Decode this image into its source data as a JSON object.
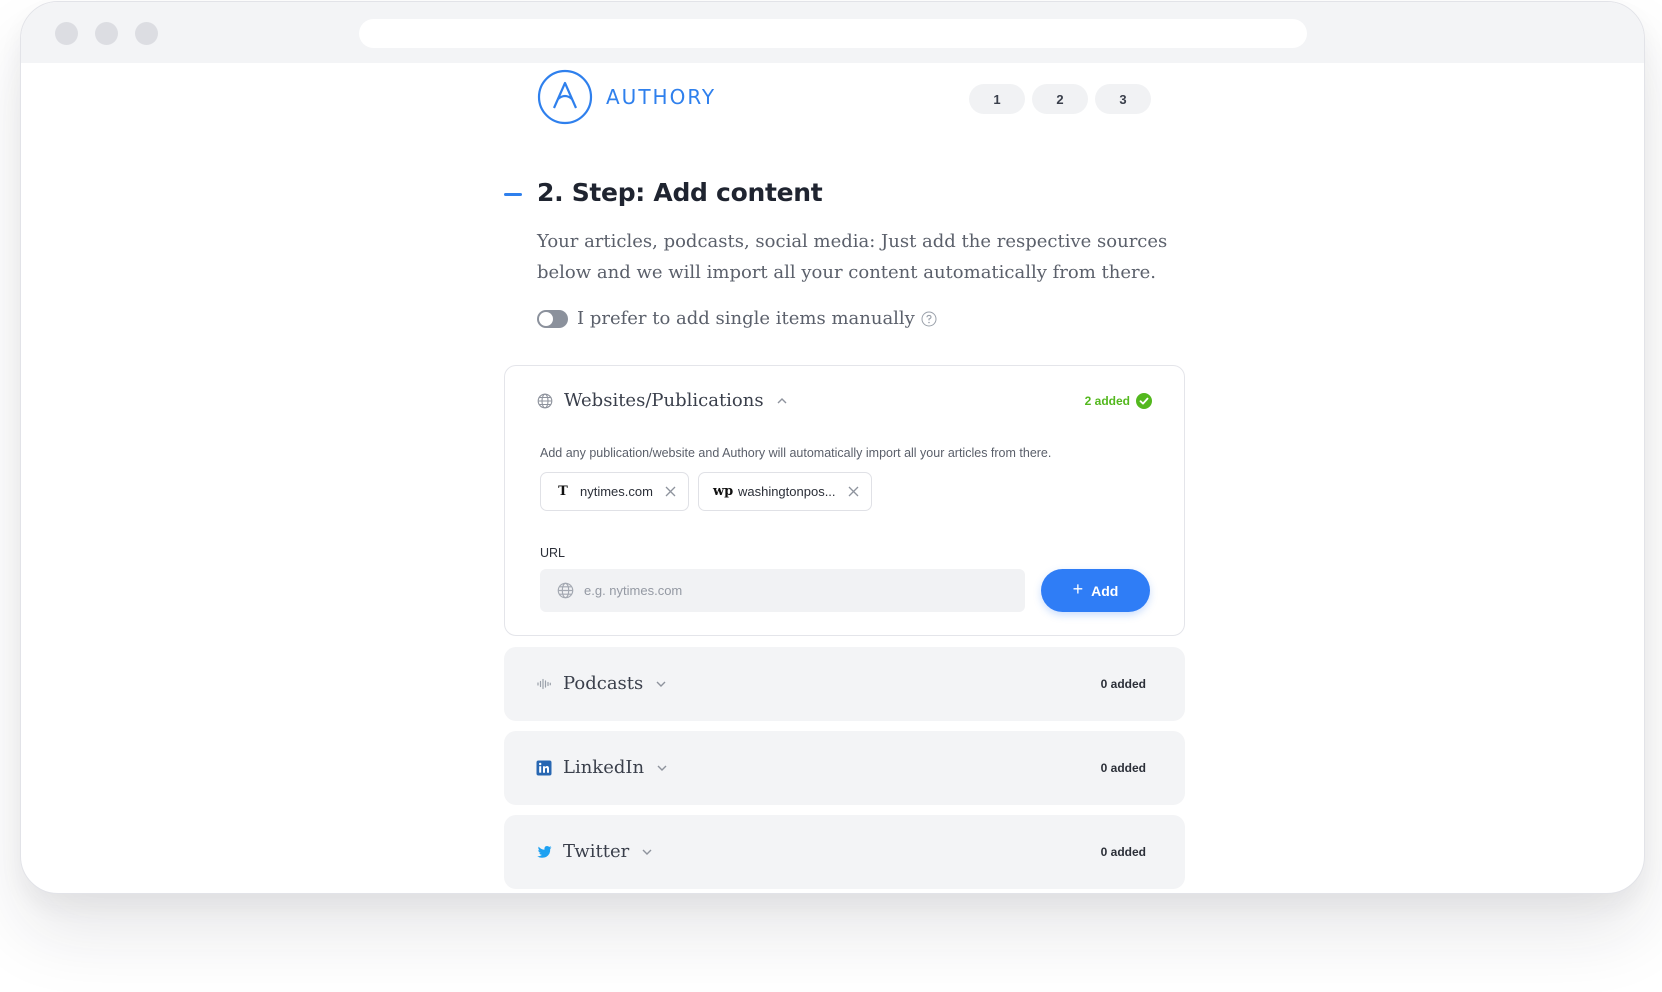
{
  "brand": {
    "name": "AUTHORY",
    "color": "#2f80ed"
  },
  "steps": [
    "1",
    "2",
    "3"
  ],
  "step": {
    "title": "2. Step: Add content",
    "description": "Your articles, podcasts, social media: Just add the respective sources below and we will import all your content automatically from there.",
    "toggle_label": "I prefer to add single items manually",
    "toggle_on": false
  },
  "websites": {
    "title": "Websites/Publications",
    "count_label": "2 added",
    "description": "Add any publication/website and Authory will automatically import all your articles from there.",
    "chips": [
      {
        "logo": "T",
        "label": "nytimes.com"
      },
      {
        "logo": "wp",
        "label": "washingtonpos..."
      }
    ],
    "url_label": "URL",
    "url_placeholder": "e.g. nytimes.com",
    "url_value": "",
    "add_label": "Add"
  },
  "sources": [
    {
      "title": "Podcasts",
      "count_label": "0 added",
      "icon": "audio-wave-icon"
    },
    {
      "title": "LinkedIn",
      "count_label": "0 added",
      "icon": "linkedin-icon"
    },
    {
      "title": "Twitter",
      "count_label": "0 added",
      "icon": "twitter-icon"
    }
  ],
  "colors": {
    "accent": "#2f7df6",
    "success": "#53b81e",
    "linkedin": "#2867b2",
    "twitter": "#1da1f2"
  }
}
